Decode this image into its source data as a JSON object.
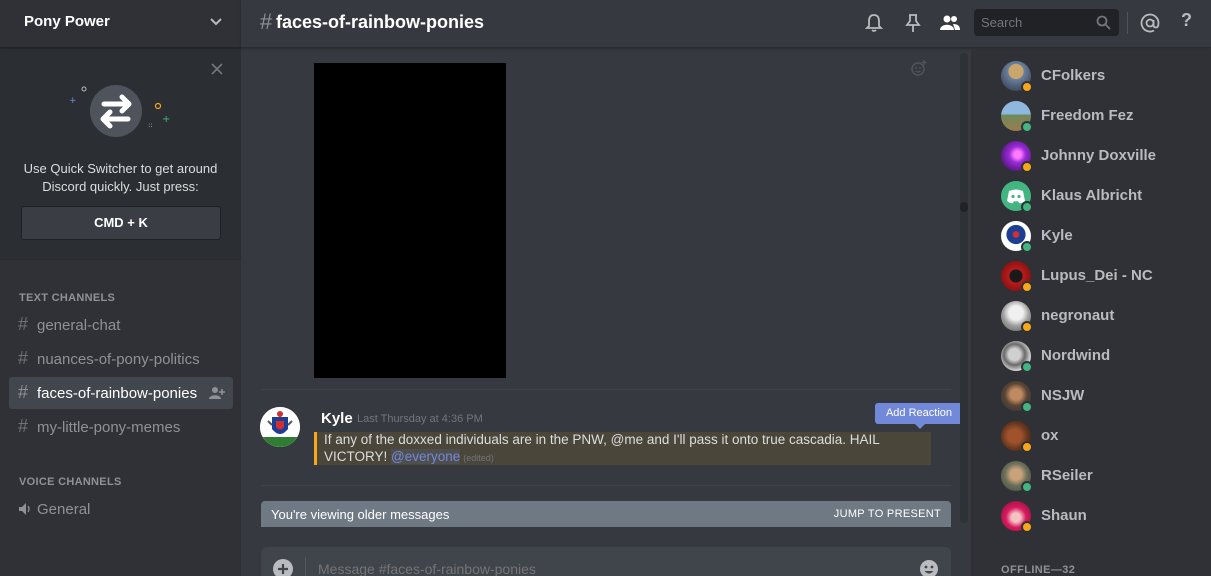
{
  "server": {
    "name": "Pony Power"
  },
  "quick_switcher": {
    "text": "Use Quick Switcher to get around Discord quickly. Just press:",
    "key": "CMD + K"
  },
  "categories": {
    "text": "TEXT CHANNELS",
    "voice": "VOICE CHANNELS"
  },
  "channels": [
    {
      "name": "general-chat",
      "active": false
    },
    {
      "name": "nuances-of-pony-politics",
      "active": false
    },
    {
      "name": "faces-of-rainbow-ponies",
      "active": true
    },
    {
      "name": "my-little-pony-memes",
      "active": false
    }
  ],
  "voice_channels": [
    {
      "name": "General"
    }
  ],
  "topbar": {
    "channel": "faces-of-rainbow-ponies",
    "search_placeholder": "Search",
    "icons": [
      "bell-icon",
      "pin-icon",
      "members-icon",
      "search-icon",
      "at-mention-icon",
      "help-icon"
    ]
  },
  "message": {
    "author": "Kyle",
    "timestamp": "Last Thursday at 4:36 PM",
    "text": "If any of the doxxed individuals are in the PNW, @me and I'll pass it onto true cascadia. HAIL VICTORY!",
    "mention": "@everyone",
    "edited": "(edited)",
    "add_reaction": "Add Reaction"
  },
  "older_messages": {
    "text": "You're viewing older messages",
    "jump": "JUMP TO PRESENT"
  },
  "input": {
    "placeholder": "Message #faces-of-rainbow-ponies"
  },
  "members": [
    {
      "name": "CFolkers",
      "status": "idle"
    },
    {
      "name": "Freedom Fez",
      "status": "online"
    },
    {
      "name": "Johnny Doxville",
      "status": "idle"
    },
    {
      "name": "Klaus Albricht",
      "status": "online"
    },
    {
      "name": "Kyle",
      "status": "online"
    },
    {
      "name": "Lupus_Dei - NC",
      "status": "idle"
    },
    {
      "name": "negronaut",
      "status": "idle"
    },
    {
      "name": "Nordwind",
      "status": "online"
    },
    {
      "name": "NSJW",
      "status": "online"
    },
    {
      "name": "ox",
      "status": "idle"
    },
    {
      "name": "RSeiler",
      "status": "online"
    },
    {
      "name": "Shaun",
      "status": "idle"
    }
  ],
  "offline_label": "OFFLINE—32",
  "colors": {
    "idle": "#faa61a",
    "online": "#43b581",
    "accent": "#7289da"
  }
}
